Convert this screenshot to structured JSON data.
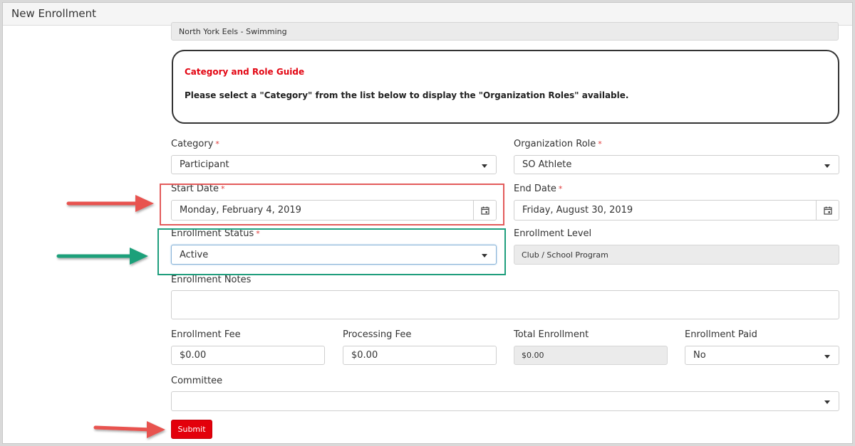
{
  "window": {
    "title": "New Enrollment"
  },
  "program": {
    "value": "North York Eels - Swimming"
  },
  "guide": {
    "title": "Category and Role Guide",
    "text": "Please select a \"Category\" from the list below to display the \"Organization Roles\" available."
  },
  "category": {
    "label": "Category",
    "required": "*",
    "value": "Participant"
  },
  "org_role": {
    "label": "Organization Role",
    "required": "*",
    "value": "SO Athlete"
  },
  "start_date": {
    "label": "Start Date",
    "required": "*",
    "value": "Monday, February 4, 2019"
  },
  "end_date": {
    "label": "End Date",
    "required": "*",
    "value": "Friday, August 30, 2019"
  },
  "status": {
    "label": "Enrollment Status",
    "required": "*",
    "value": "Active"
  },
  "level": {
    "label": "Enrollment Level",
    "value": "Club / School Program"
  },
  "notes": {
    "label": "Enrollment Notes",
    "value": ""
  },
  "fee": {
    "label": "Enrollment Fee",
    "value": "$0.00"
  },
  "processing": {
    "label": "Processing Fee",
    "value": "$0.00"
  },
  "total": {
    "label": "Total Enrollment",
    "value": "$0.00"
  },
  "paid": {
    "label": "Enrollment Paid",
    "value": "No"
  },
  "committee": {
    "label": "Committee",
    "value": ""
  },
  "submit": {
    "label": "Submit"
  },
  "colors": {
    "accent_red": "#e3000b",
    "highlight_red": "#e35b5b",
    "highlight_green": "#1f9e7d",
    "arrow_red": "#e8524f",
    "arrow_green": "#1fa07a"
  }
}
